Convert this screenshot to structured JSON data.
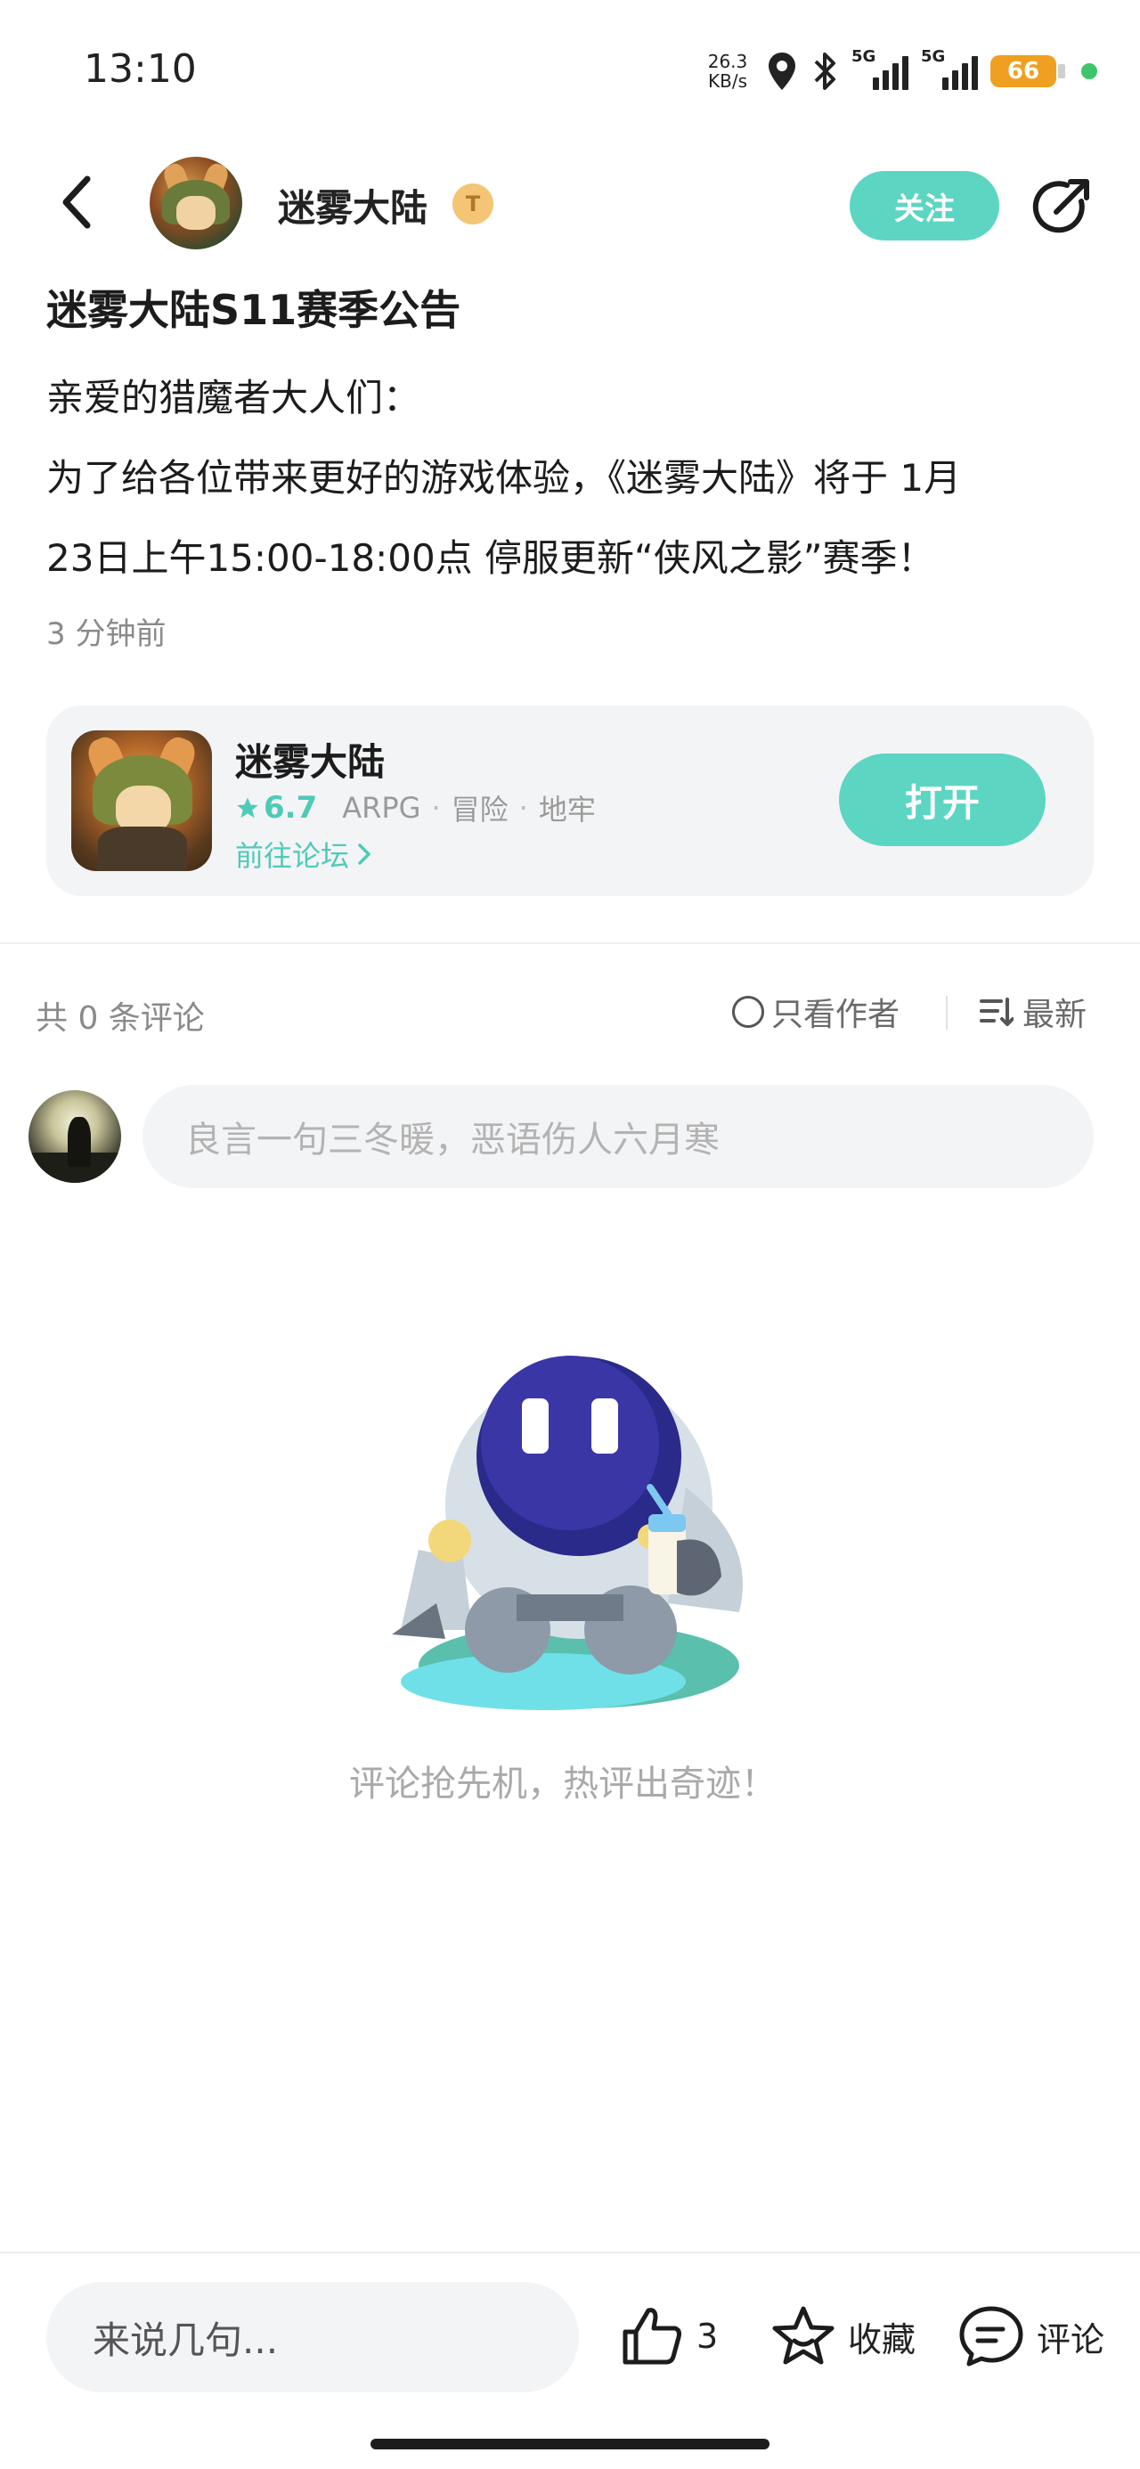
{
  "status_bar": {
    "time": "13:10",
    "net_speed_value": "26.3",
    "net_speed_unit": "KB/s",
    "signal1": "5G",
    "signal2": "5G",
    "battery": "66"
  },
  "header": {
    "author_name": "迷雾大陆",
    "badge_text": "T",
    "follow_label": "关注"
  },
  "post": {
    "title": "迷雾大陆S11赛季公告",
    "paragraphs": [
      "亲爱的猎魔者大人们：",
      "为了给各位带来更好的游戏体验，《迷雾大陆》将于 1月",
      "23日上午15:00-18:00点 停服更新“侠风之影”赛季！"
    ],
    "time_ago": "3 分钟前"
  },
  "game_card": {
    "name": "迷雾大陆",
    "rating": "6.7",
    "tags": [
      "ARPG",
      "冒险",
      "地牢"
    ],
    "forum_link": "前往论坛",
    "open_label": "打开"
  },
  "comments": {
    "count_label": "共 0 条评论",
    "author_only_label": "只看作者",
    "sort_label": "最新",
    "input_placeholder": "良言一句三冬暖，恶语伤人六月寒",
    "empty_text": "评论抢先机，热评出奇迹！"
  },
  "bottom_bar": {
    "input_placeholder": "来说几句...",
    "like_count": "3",
    "favorite_label": "收藏",
    "comment_label": "评论"
  },
  "colors": {
    "accent": "#5dd5c3",
    "accent_text": "#4fcab7",
    "battery": "#f0a020",
    "status_dot": "#3ec46b"
  },
  "icons": [
    "back-arrow-icon",
    "share-icon",
    "star-icon",
    "chevron-right-icon",
    "radio-icon",
    "sort-icon",
    "like-icon",
    "favorite-icon",
    "comment-icon",
    "location-icon",
    "bluetooth-icon"
  ]
}
